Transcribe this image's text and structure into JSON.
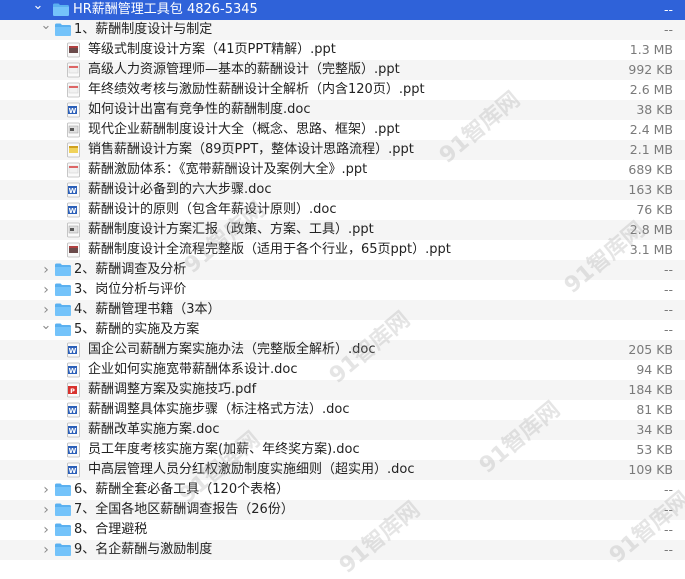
{
  "watermark_text": "91智库网",
  "rows": [
    {
      "kind": "folder",
      "level": 0,
      "expanded": true,
      "selected": true,
      "label": "HR薪酬管理工具包 4826-5345",
      "size": "--"
    },
    {
      "kind": "folder",
      "level": 1,
      "expanded": true,
      "label": "1、薪酬制度设计与制定",
      "size": "--"
    },
    {
      "kind": "file",
      "level": 2,
      "ftype": "ppt-dark",
      "label": "等级式制度设计方案（41页PPT精解）.ppt",
      "size": "1.3 MB"
    },
    {
      "kind": "file",
      "level": 2,
      "ftype": "ppt",
      "label": "高级人力资源管理师—基本的薪酬设计（完整版）.ppt",
      "size": "992 KB"
    },
    {
      "kind": "file",
      "level": 2,
      "ftype": "ppt",
      "label": "年终绩效考核与激励性薪酬设计全解析（内含120页）.ppt",
      "size": "2.6 MB"
    },
    {
      "kind": "file",
      "level": 2,
      "ftype": "doc",
      "label": "如何设计出富有竞争性的薪酬制度.doc",
      "size": "38 KB"
    },
    {
      "kind": "file",
      "level": 2,
      "ftype": "ppt-gray",
      "label": "现代企业薪酬制度设计大全（概念、思路、框架）.ppt",
      "size": "2.4 MB"
    },
    {
      "kind": "file",
      "level": 2,
      "ftype": "ppt-yellow",
      "label": "销售薪酬设计方案（89页PPT，整体设计思路流程）.ppt",
      "size": "2.1 MB"
    },
    {
      "kind": "file",
      "level": 2,
      "ftype": "ppt",
      "label": "薪酬激励体系：《宽带薪酬设计及案例大全》.ppt",
      "size": "689 KB"
    },
    {
      "kind": "file",
      "level": 2,
      "ftype": "doc",
      "label": "薪酬设计必备到的六大步骤.doc",
      "size": "163 KB"
    },
    {
      "kind": "file",
      "level": 2,
      "ftype": "doc",
      "label": "薪酬设计的原则（包含年薪设计原则）.doc",
      "size": "76 KB"
    },
    {
      "kind": "file",
      "level": 2,
      "ftype": "ppt-gray",
      "label": "薪酬制度设计方案汇报（政策、方案、工具）.ppt",
      "size": "2.8 MB"
    },
    {
      "kind": "file",
      "level": 2,
      "ftype": "ppt-dark",
      "label": "薪酬制度设计全流程完整版（适用于各个行业，65页ppt）.ppt",
      "size": "3.1 MB"
    },
    {
      "kind": "folder",
      "level": 1,
      "expanded": false,
      "label": "2、薪酬调查及分析",
      "size": "--"
    },
    {
      "kind": "folder",
      "level": 1,
      "expanded": false,
      "label": "3、岗位分析与评价",
      "size": "--"
    },
    {
      "kind": "folder",
      "level": 1,
      "expanded": false,
      "label": "4、薪酬管理书籍（3本）",
      "size": "--"
    },
    {
      "kind": "folder",
      "level": 1,
      "expanded": true,
      "label": "5、薪酬的实施及方案",
      "size": "--"
    },
    {
      "kind": "file",
      "level": 2,
      "ftype": "doc",
      "label": "国企公司薪酬方案实施办法（完整版全解析）.doc",
      "size": "205 KB"
    },
    {
      "kind": "file",
      "level": 2,
      "ftype": "doc",
      "label": "企业如何实施宽带薪酬体系设计.doc",
      "size": "94 KB"
    },
    {
      "kind": "file",
      "level": 2,
      "ftype": "pdf",
      "label": "薪酬调整方案及实施技巧.pdf",
      "size": "184 KB"
    },
    {
      "kind": "file",
      "level": 2,
      "ftype": "doc",
      "label": "薪酬调整具体实施步骤（标注格式方法）.doc",
      "size": "81 KB"
    },
    {
      "kind": "file",
      "level": 2,
      "ftype": "doc",
      "label": "薪酬改革实施方案.doc",
      "size": "34 KB"
    },
    {
      "kind": "file",
      "level": 2,
      "ftype": "doc",
      "label": "员工年度考核实施方案(加薪、年终奖方案).doc",
      "size": "53 KB"
    },
    {
      "kind": "file",
      "level": 2,
      "ftype": "doc",
      "label": "中高层管理人员分红权激励制度实施细则（超实用）.doc",
      "size": "109 KB"
    },
    {
      "kind": "folder",
      "level": 1,
      "expanded": false,
      "label": "6、薪酬全套必备工具（120个表格）",
      "size": "--"
    },
    {
      "kind": "folder",
      "level": 1,
      "expanded": false,
      "label": "7、全国各地区薪酬调查报告（26份）",
      "size": "--"
    },
    {
      "kind": "folder",
      "level": 1,
      "expanded": false,
      "label": "8、合理避税",
      "size": "--"
    },
    {
      "kind": "folder",
      "level": 1,
      "expanded": false,
      "label": "9、名企薪酬与激励制度",
      "size": "--"
    }
  ]
}
